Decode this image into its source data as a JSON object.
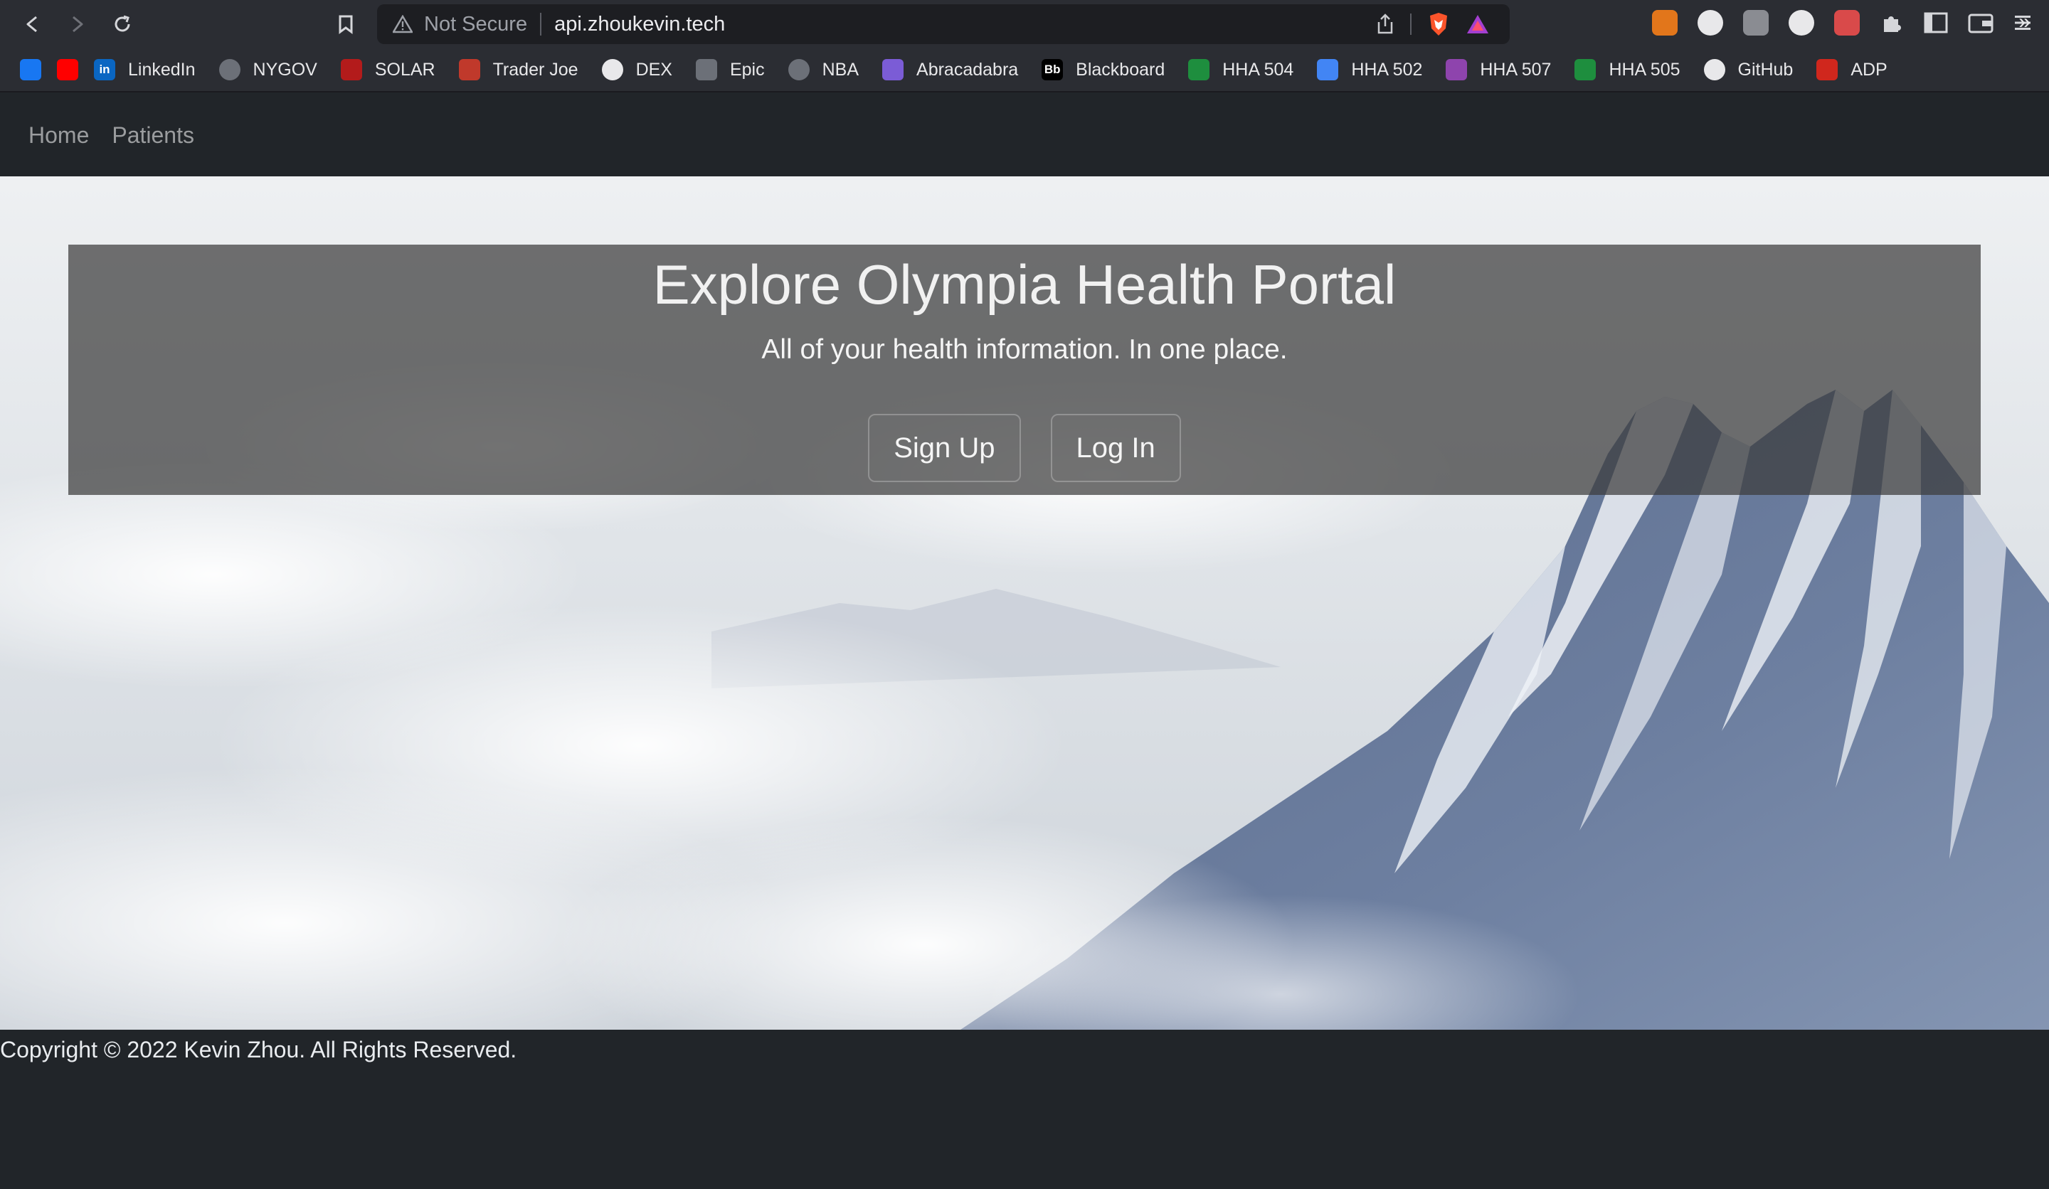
{
  "browser": {
    "security_label": "Not Secure",
    "url": "api.zhoukevin.tech",
    "bookmarks": [
      {
        "label": "",
        "icon": "facebook-icon",
        "color": "#1877f2"
      },
      {
        "label": "",
        "icon": "youtube-icon",
        "color": "#ff0000"
      },
      {
        "label": "LinkedIn",
        "icon": "linkedin-icon",
        "color": "#0a66c2"
      },
      {
        "label": "NYGOV",
        "icon": "globe-icon",
        "color": "#6c7078"
      },
      {
        "label": "SOLAR",
        "icon": "shield-icon",
        "color": "#b31b1b"
      },
      {
        "label": "Trader Joe",
        "icon": "box-icon",
        "color": "#c0392b"
      },
      {
        "label": "DEX",
        "icon": "owl-icon",
        "color": "#e8e8ea"
      },
      {
        "label": "Epic",
        "icon": "epic-icon",
        "color": "#6c7078"
      },
      {
        "label": "NBA",
        "icon": "globe-icon",
        "color": "#6c7078"
      },
      {
        "label": "Abracadabra",
        "icon": "crystal-icon",
        "color": "#7b5cd6"
      },
      {
        "label": "Blackboard",
        "icon": "blackboard-icon",
        "color": "#000000"
      },
      {
        "label": "HHA 504",
        "icon": "classroom-icon",
        "color": "#1e8e3e"
      },
      {
        "label": "HHA 502",
        "icon": "classroom-icon",
        "color": "#4285f4"
      },
      {
        "label": "HHA 507",
        "icon": "classroom-icon",
        "color": "#8e44ad"
      },
      {
        "label": "HHA 505",
        "icon": "classroom-icon",
        "color": "#1e8e3e"
      },
      {
        "label": "GitHub",
        "icon": "github-icon",
        "color": "#e8e8ea"
      },
      {
        "label": "ADP",
        "icon": "adp-icon",
        "color": "#d0271d"
      }
    ],
    "bookmarks_more": "»",
    "bookmark_icon_text": {
      "blackboard": "Bb",
      "linkedin": "in"
    }
  },
  "nav": {
    "links": [
      "Home",
      "Patients"
    ]
  },
  "hero": {
    "title": "Explore Olympia Health Portal",
    "subtitle": "All of your health information. In one place.",
    "signup_label": "Sign Up",
    "login_label": "Log In"
  },
  "footer": {
    "copyright": "Copyright © 2022 Kevin Zhou. All Rights Reserved."
  }
}
